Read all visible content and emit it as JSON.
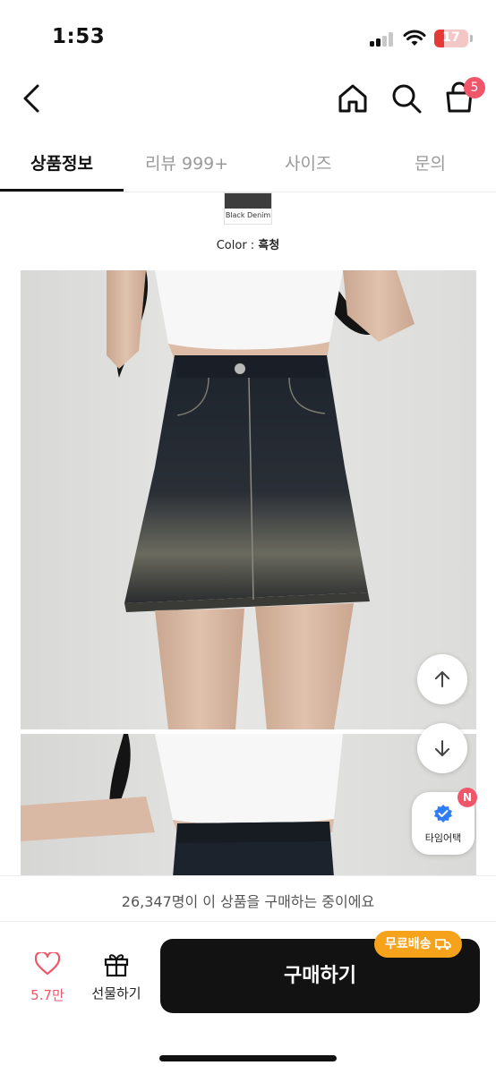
{
  "status_bar": {
    "time": "1:53",
    "battery": "17"
  },
  "header": {
    "back": "back-icon",
    "home": "home-icon",
    "search": "search-icon",
    "cart": "cart-icon",
    "cart_count": "5"
  },
  "tabs": [
    {
      "label": "상품정보",
      "active": true
    },
    {
      "label": "리뷰 999+",
      "active": false
    },
    {
      "label": "사이즈",
      "active": false
    },
    {
      "label": "문의",
      "active": false
    }
  ],
  "product": {
    "swatch_label": "Black Denim",
    "swatch_color": "#3d3d3d",
    "color_prefix": "Color : ",
    "color_value": "흑청"
  },
  "floating": {
    "scroll_up": "arrow-up-icon",
    "scroll_down": "arrow-down-icon",
    "time_attack_label": "타임어택",
    "time_attack_badge": "N"
  },
  "purchase_note": "26,347명이 이 상품을 구매하는 중이에요",
  "bottom_bar": {
    "like_count": "5.7만",
    "gift_label": "선물하기",
    "buy_label": "구매하기",
    "free_shipping": "무료배송"
  },
  "colors": {
    "accent_pink": "#f0566a",
    "free_ship_orange": "#f7a21b",
    "buy_button": "#121212"
  }
}
